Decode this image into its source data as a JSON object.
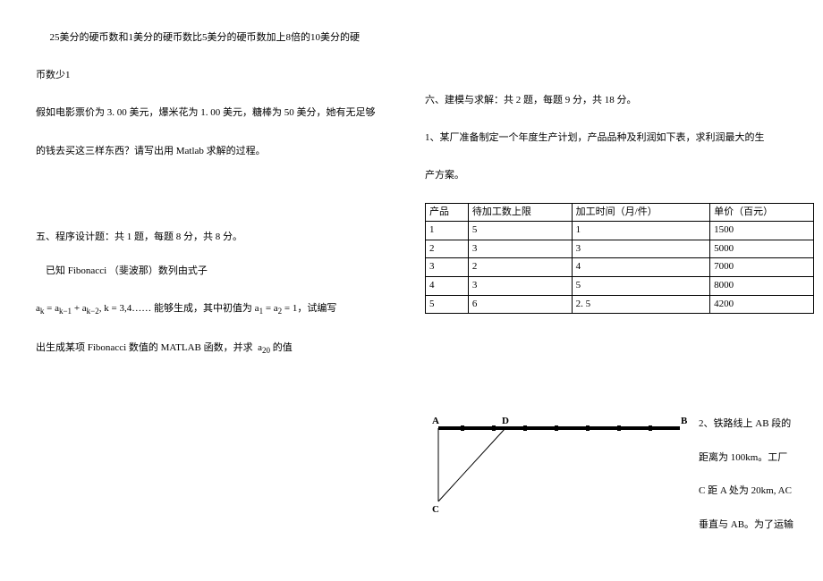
{
  "left": {
    "line1": " 25美分的硬币数和1美分的硬币数比5美分的硬币数加上8倍的10美分的硬",
    "line2": "币数少1",
    "line3": "假如电影票价为 3. 00 美元，爆米花为 1. 00 美元，糖棒为 50 美分，她有无足够",
    "line4": "的钱去买这三样东西？请写出用 Matlab 求解的过程。",
    "section5_title": "五、程序设计题：共 1 题，每题 8 分，共 8 分。",
    "fib_line1": " 已知 Fibonacci （斐波那）数列由式子",
    "fib_formula_prefix": "a",
    "fib_text_k": " = a",
    "fib_km1": "k−1",
    "fib_plus": " + a",
    "fib_km2": "k−2",
    "fib_rest": ", k = 3,4…… 能够生成，其中初值为 a",
    "fib_init": "1",
    "fib_eq": " = a",
    "fib_init2": "2",
    "fib_end": " = 1，试编写",
    "fib_line3_a": "出生成某项 Fibonacci 数值的 MATLAB 函数，并求 ",
    "fib_line3_b": "a",
    "fib_line3_sub": "20",
    "fib_line3_c": " 的值"
  },
  "right": {
    "section6_title": "六、建模与求解：共 2 题，每题 9 分，共 18 分。",
    "q1_a": "1、某厂准备制定一个年度生产计划，产品品种及利润如下表，求利润最大的生",
    "q1_b": "产方案。",
    "table": {
      "headers": [
        "产品",
        "待加工数上限",
        "加工时间（月/件）",
        "单价（百元）"
      ],
      "rows": [
        [
          "1",
          "5",
          "1",
          "1500"
        ],
        [
          "2",
          "3",
          "3",
          "5000"
        ],
        [
          "3",
          "2",
          "4",
          "7000"
        ],
        [
          "4",
          "3",
          "5",
          "8000"
        ],
        [
          "5",
          "6",
          "2. 5",
          "4200"
        ]
      ]
    },
    "q2_a": "2、铁路线上 AB 段的",
    "q2_b": "距离为 100km。工厂",
    "q2_c": "C 距 A 处为 20km, AC",
    "q2_d": "垂直与 AB。为了运输",
    "labels": {
      "A": "A",
      "B": "B",
      "C": "C",
      "D": "D"
    }
  },
  "chart_data": {
    "type": "table",
    "title": "产品品种及利润",
    "columns": [
      "产品",
      "待加工数上限",
      "加工时间（月/件）",
      "单价（百元）"
    ],
    "rows": [
      [
        1,
        5,
        1,
        1500
      ],
      [
        2,
        3,
        3,
        5000
      ],
      [
        3,
        2,
        4,
        7000
      ],
      [
        4,
        3,
        5,
        8000
      ],
      [
        5,
        6,
        2.5,
        4200
      ]
    ]
  }
}
